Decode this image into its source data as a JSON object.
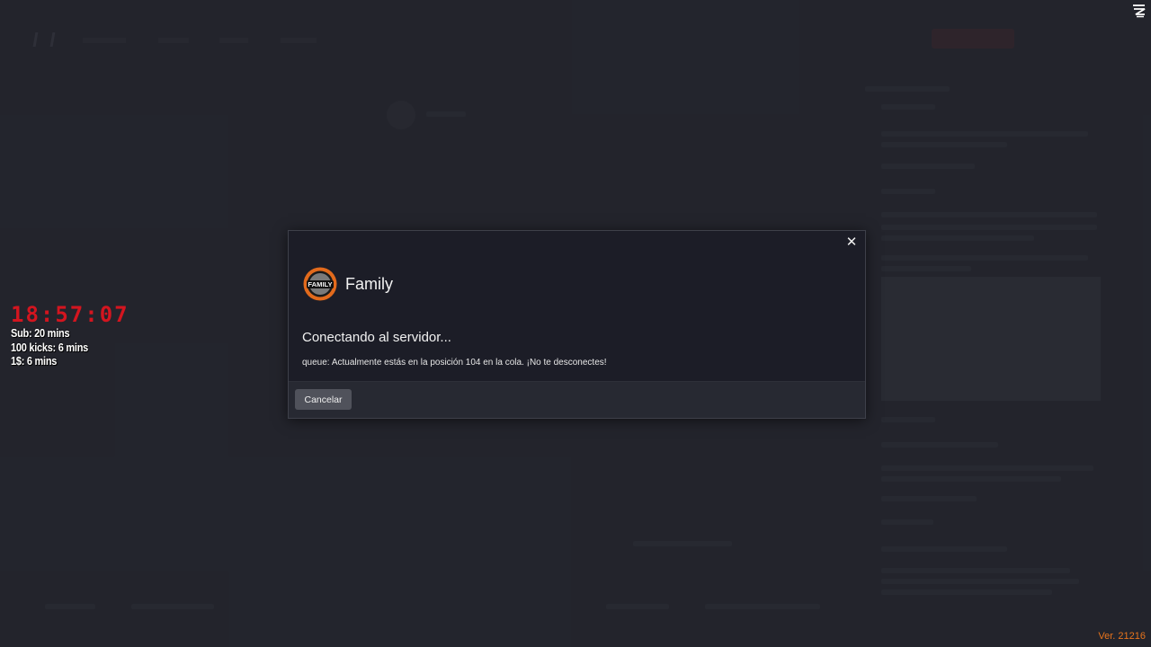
{
  "colors": {
    "timer_clock": "#d3151f",
    "version": "#e8741c",
    "modal_bg": "#1c1d27",
    "footer_bg": "#272932",
    "cancel_bg": "#50525b",
    "logo_orange": "#e26a1c"
  },
  "timer": {
    "clock": "18:57:07",
    "lines": [
      "Sub: 20 mins",
      "100 kicks: 6 mins",
      "1$: 6 mins"
    ]
  },
  "modal": {
    "server_name": "Family",
    "logo_text": "FAMILY",
    "close_icon": "close-icon",
    "connecting_title": "Conectando al servidor...",
    "queue_message": "queue: Actualmente estás en la posición 104 en la cola. ¡No te desconectes!",
    "cancel_label": "Cancelar"
  },
  "version": "Ver. 21216"
}
